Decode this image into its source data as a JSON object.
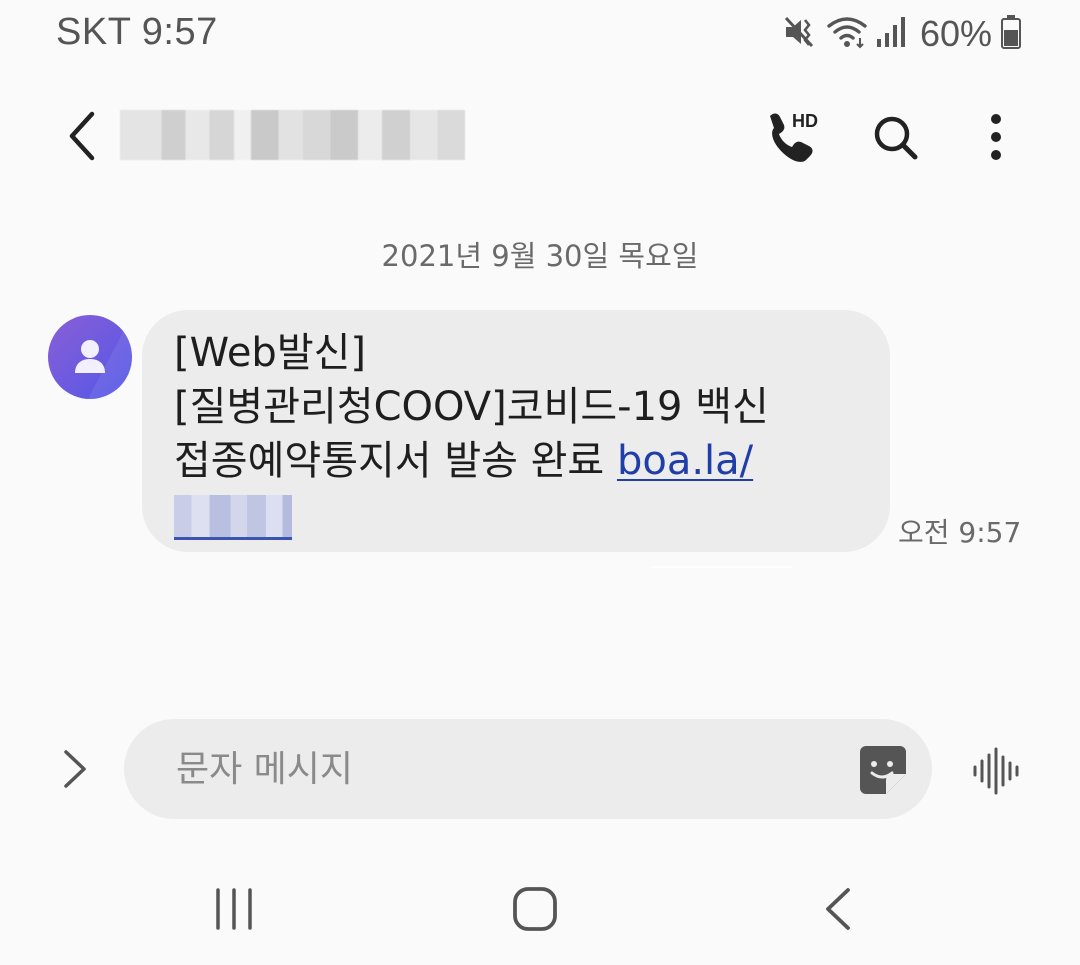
{
  "status_bar": {
    "carrier": "SKT",
    "time": "9:57",
    "battery": "60%",
    "icons": [
      "mute-icon",
      "wifi-icon",
      "signal-icon",
      "battery-icon"
    ]
  },
  "header": {
    "icons": [
      "back-arrow-icon",
      "hd-call-icon",
      "search-icon",
      "more-icon"
    ],
    "hd_badge": "HD"
  },
  "conversation": {
    "date_separator": "2021년 9월 30일 목요일",
    "messages": [
      {
        "lines": [
          "[Web발신]",
          "[질병관리청COOV]코비드-19 백신"
        ],
        "line3_text": "접종예약통지서 발송 완료 ",
        "link_text": "boa.la/",
        "time": "오전 9:57"
      }
    ]
  },
  "composer": {
    "placeholder": "문자 메시지",
    "icons": [
      "expand-icon",
      "sticker-icon",
      "voice-input-icon"
    ]
  },
  "nav_bar": {
    "icons": [
      "recents-icon",
      "home-icon",
      "nav-back-icon"
    ]
  },
  "colors": {
    "background": "#fafafa",
    "bubble": "#ececec",
    "link": "#1f3ea8",
    "avatar_start": "#8a5fd6",
    "avatar_end": "#4f57e8"
  }
}
